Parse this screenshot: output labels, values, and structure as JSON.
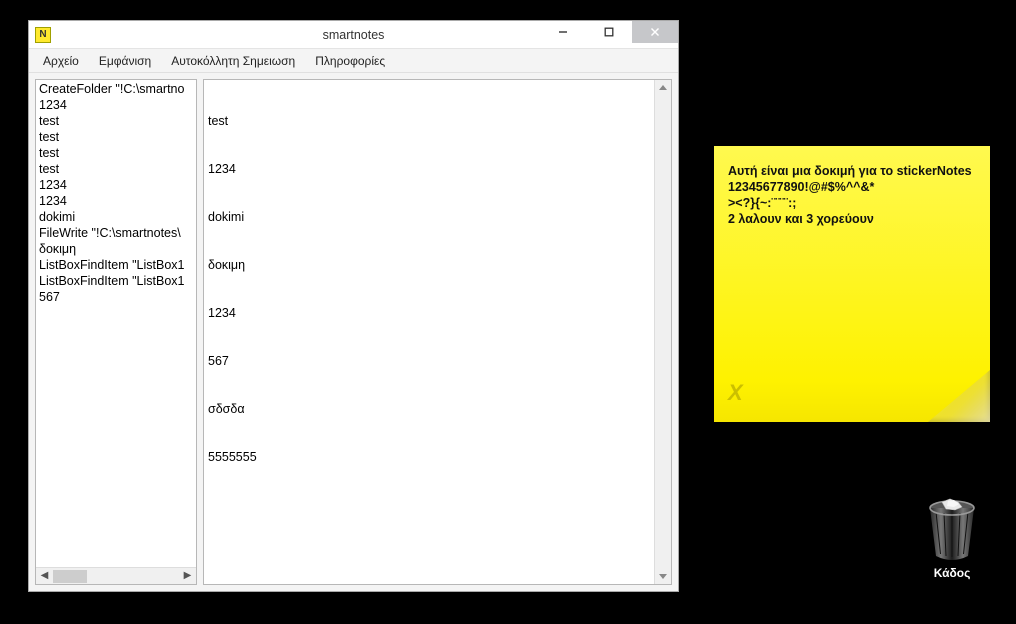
{
  "window": {
    "title": "smartnotes",
    "menu": [
      "Αρχείο",
      "Εμφάνιση",
      "Αυτοκόλλητη Σημειωση",
      "Πληροφορίες"
    ]
  },
  "listbox": {
    "items": [
      "CreateFolder \"!C:\\smartno",
      "1234",
      "test",
      "test",
      "test",
      "test",
      "1234",
      "1234",
      "dokimi",
      "FileWrite \"!C:\\smartnotes\\",
      "δοκιμη",
      "ListBoxFindItem \"ListBox1",
      "ListBoxFindItem \"ListBox1",
      "567"
    ]
  },
  "editor": {
    "lines": [
      "test",
      "1234",
      "dokimi",
      "δοκιμη",
      "1234",
      "567",
      "σδσδα",
      "5555555"
    ]
  },
  "sticky": {
    "lines": [
      "Αυτή είναι μια δοκιμή για το stickerNotes",
      "12345677890!@#$%^^&*",
      "><?}{~:¨¨¨¨:;",
      "2 λαλουν και 3 χορεύουν"
    ],
    "corner_mark": "X"
  },
  "desktop": {
    "trash_label": "Κάδος"
  }
}
